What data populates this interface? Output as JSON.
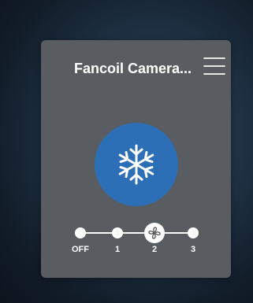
{
  "header": {
    "title": "Fancoil Camera..."
  },
  "icons": {
    "menu": "hamburger-icon",
    "mode": "snowflake-icon",
    "speed": "fan-icon"
  },
  "colors": {
    "accent": "#2d6fb6",
    "card": "#595c60"
  },
  "fan_speed": {
    "levels": [
      "OFF",
      "1",
      "2",
      "3"
    ],
    "selected": "2"
  }
}
